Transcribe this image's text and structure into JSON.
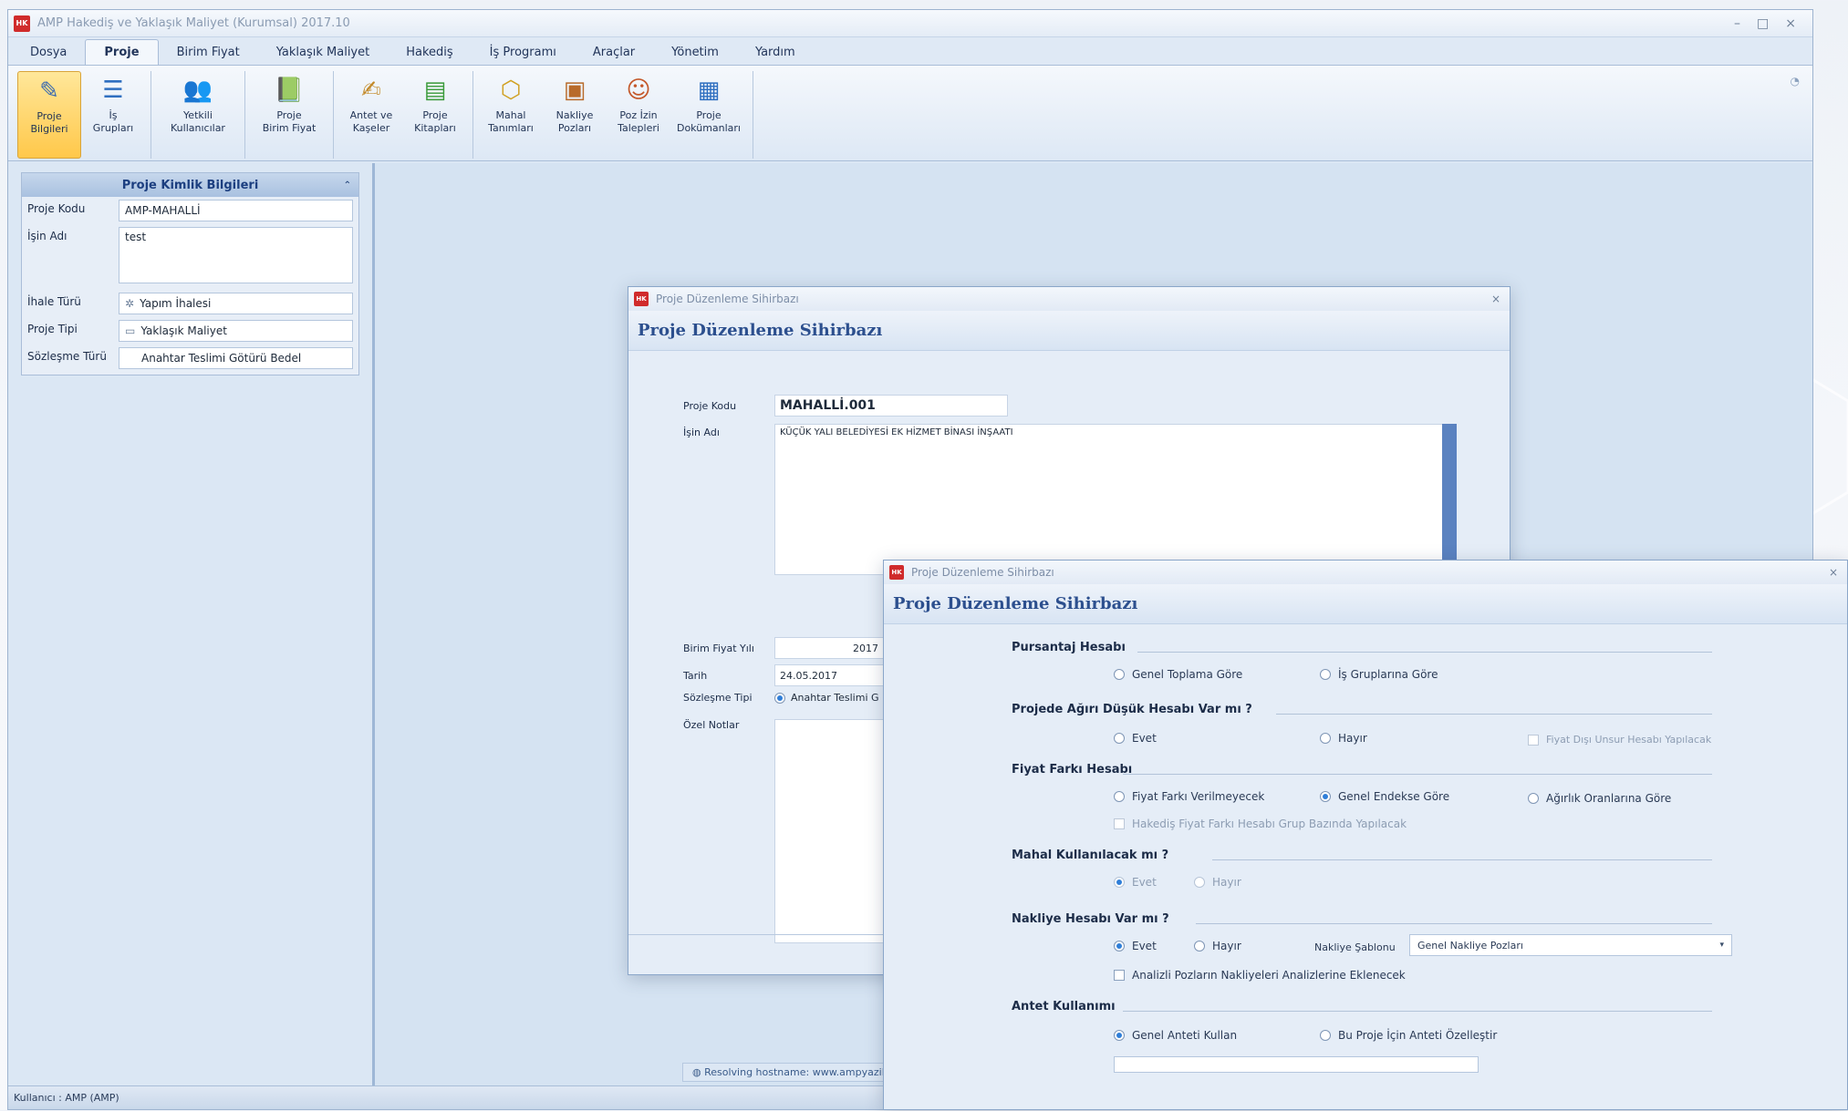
{
  "app": {
    "title": "AMP Hakediş ve Yaklaşık Maliyet (Kurumsal) 2017.10",
    "icon_text": "HK",
    "tabs": [
      "Dosya",
      "Proje",
      "Birim Fiyat",
      "Yaklaşık Maliyet",
      "Hakediş",
      "İş Programı",
      "Araçlar",
      "Yönetim",
      "Yardım"
    ],
    "active_tab": "Proje",
    "ribbon": [
      {
        "label": "Proje\nBilgileri",
        "icon": "edit-icon",
        "active": true
      },
      {
        "label": "İş\nGrupları",
        "icon": "tree-icon"
      },
      {
        "label": "Yetkili\nKullanıcılar",
        "icon": "users-icon"
      },
      {
        "label": "Proje\nBirim Fiyat",
        "icon": "book-icon"
      },
      {
        "label": "Antet ve\nKaşeler",
        "icon": "stamp-icon"
      },
      {
        "label": "Proje\nKitapları",
        "icon": "books-icon"
      },
      {
        "label": "Mahal\nTanımları",
        "icon": "box-icon"
      },
      {
        "label": "Nakliye\nPozları",
        "icon": "truck-icon"
      },
      {
        "label": "Poz İzin\nTalepleri",
        "icon": "person-icon"
      },
      {
        "label": "Proje\nDokümanları",
        "icon": "window-icon"
      }
    ],
    "status_user": "Kullanıcı : AMP (AMP)",
    "resolving": "Resolving hostname: www.ampyazilim..."
  },
  "info_panel": {
    "title": "Proje Kimlik Bilgileri",
    "fields": [
      {
        "label": "Proje Kodu",
        "value": "AMP-MAHALLİ"
      },
      {
        "label": "İşin Adı",
        "value": "test"
      },
      {
        "label": "İhale Türü",
        "value": "Yapım İhalesi"
      },
      {
        "label": "Proje Tipi",
        "value": "Yaklaşık Maliyet"
      },
      {
        "label": "Sözleşme Türü",
        "value": "Anahtar Teslimi Götürü Bedel"
      }
    ]
  },
  "dialog1": {
    "window_title": "Proje Düzenleme Sihirbazı",
    "header": "Proje Düzenleme Sihirbazı",
    "fields": {
      "proje_kodu_label": "Proje Kodu",
      "proje_kodu": "MAHALLİ.001",
      "isin_adi_label": "İşin Adı",
      "isin_adi": "KÜÇÜK YALI BELEDİYESİ EK HİZMET BİNASI İNŞAATI",
      "birim_fiyat_yili_label": "Birim Fiyat Yılı",
      "birim_fiyat_yili": "2017",
      "tarih_label": "Tarih",
      "tarih": "24.05.2017",
      "sozlesme_tipi_label": "Sözleşme Tipi",
      "sozlesme_tipi": "Anahtar Teslimi G",
      "ozel_notlar_label": "Özel Notlar"
    }
  },
  "dialog2": {
    "window_title": "Proje Düzenleme Sihirbazı",
    "header": "Proje Düzenleme Sihirbazı",
    "sections": {
      "pursantaj": "Pursantaj Hesabı",
      "pursantaj_opts": [
        "Genel Toplama Göre",
        "İş Gruplarına Göre"
      ],
      "agir_duyuk": "Projede Ağırı Düşük Hesabı Var mı ?",
      "agir_opts": [
        "Evet",
        "Hayır"
      ],
      "agir_check": "Fiyat Dışı Unsur Hesabı Yapılacak",
      "fiyat_farki": "Fiyat Farkı Hesabı",
      "fiyat_opts": [
        "Fiyat Farkı Verilmeyecek",
        "Genel Endekse Göre",
        "Ağırlık Oranlarına Göre"
      ],
      "fiyat_check": "Hakediş Fiyat Farkı Hesabı Grup Bazında Yapılacak",
      "mahal": "Mahal Kullanılacak mı ?",
      "mahal_opts": [
        "Evet",
        "Hayır"
      ],
      "nakliye": "Nakliye Hesabı Var mı ?",
      "nakliye_opts": [
        "Evet",
        "Hayır"
      ],
      "nakliye_sablon_label": "Nakliye Şablonu",
      "nakliye_sablon": "Genel Nakliye Pozları",
      "nakliye_check": "Analizli Pozların Nakliyeleri Analizlerine Eklenecek",
      "antet": "Antet Kullanımı",
      "antet_opts": [
        "Genel Anteti Kullan",
        "Bu Proje İçin Anteti Özelleştir"
      ]
    }
  },
  "colors": {
    "accent": "#2c4f8e",
    "panel": "#dbe7f4",
    "ribbon_active": "#ffc84a"
  }
}
